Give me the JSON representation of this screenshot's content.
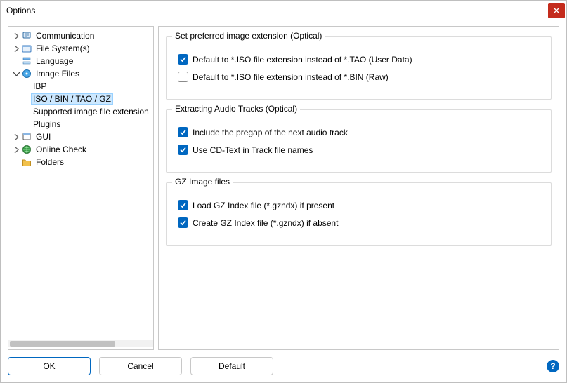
{
  "window": {
    "title": "Options"
  },
  "tree": {
    "communication": "Communication",
    "file_system": "File System(s)",
    "language": "Language",
    "image_files": "Image Files",
    "ibp": "IBP",
    "iso_bin_tao_gz": "ISO / BIN / TAO / GZ",
    "supported_ext": "Supported image file extension",
    "plugins": "Plugins",
    "gui": "GUI",
    "online_check": "Online Check",
    "folders": "Folders"
  },
  "groups": {
    "preferred_ext": {
      "title": "Set preferred image extension (Optical)",
      "iso_tao": "Default to *.ISO file extension instead of *.TAO (User Data)",
      "iso_bin": "Default to *.ISO file extension instead of *.BIN (Raw)"
    },
    "extract_audio": {
      "title": "Extracting Audio Tracks (Optical)",
      "pregap": "Include the pregap of the next audio track",
      "cdtext": "Use CD-Text in Track file names"
    },
    "gz": {
      "title": "GZ Image files",
      "load": "Load GZ Index file (*.gzndx) if present",
      "create": "Create GZ Index file (*.gzndx) if absent"
    }
  },
  "buttons": {
    "ok": "OK",
    "cancel": "Cancel",
    "default": "Default"
  },
  "help": "?"
}
